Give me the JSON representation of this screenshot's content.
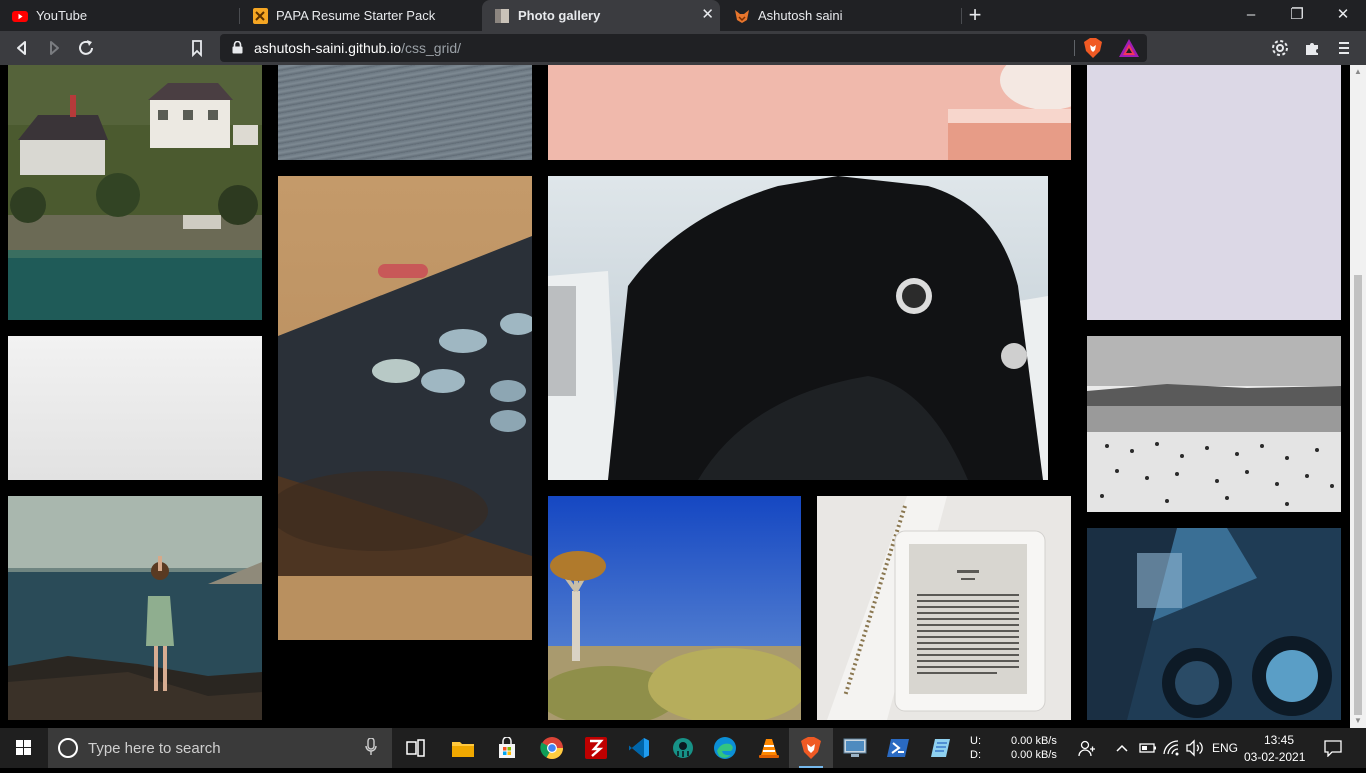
{
  "browser": {
    "tabs": [
      {
        "title": "YouTube",
        "icon": "youtube-icon"
      },
      {
        "title": "PAPA Resume Starter Pack",
        "icon": "resume-icon"
      },
      {
        "title": "Photo gallery",
        "icon": "photo-icon",
        "active": true
      },
      {
        "title": "Ashutosh saini",
        "icon": "fox-icon"
      }
    ],
    "new_tab_glyph": "+",
    "window_controls": {
      "minimize": "–",
      "restore": "❐",
      "close": "✕"
    },
    "url_host": "ashutosh-saini.github.io",
    "url_path": "/css_grid/",
    "toolbar_icons": [
      "back-icon",
      "forward-icon",
      "reload-icon",
      "bookmark-icon",
      "lock-icon",
      "brave-shield-icon",
      "brave-rewards-icon",
      "extensions-icon",
      "menu-icon"
    ]
  },
  "gallery": {
    "photos": [
      "lakeside-houses-photo",
      "ocean-water-photo",
      "pink-wall-photo",
      "lavender-plain-photo",
      "white-plain-photo",
      "remote-control-photo",
      "wetsuit-surfer-photo",
      "beach-crowd-photo",
      "woman-on-rocks-photo",
      "quiver-tree-photo",
      "ereader-notebook-photo",
      "car-dashboard-photo"
    ]
  },
  "taskbar": {
    "search_placeholder": "Type here to search",
    "apps": [
      "task-view-icon",
      "file-explorer-icon",
      "microsoft-store-icon",
      "chrome-icon",
      "filezilla-icon",
      "vscode-icon",
      "gitkraken-icon",
      "edge-icon",
      "vlc-icon",
      "brave-icon",
      "remote-desktop-icon",
      "powershell-icon",
      "notepad-icon"
    ],
    "network_up_label": "U:",
    "network_down_label": "D:",
    "upload_speed": "0.00 kB/s",
    "download_speed": "0.00 kB/s",
    "language": "ENG",
    "time": "13:45",
    "date": "03-02-2021"
  }
}
